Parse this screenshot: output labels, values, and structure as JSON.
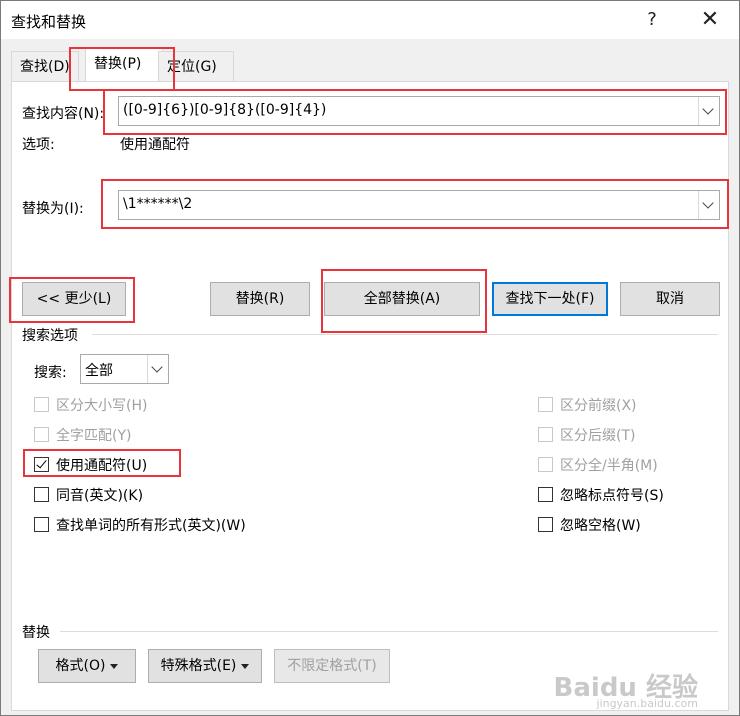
{
  "title": "查找和替换",
  "title_buttons": {
    "help": "?",
    "close": "✕"
  },
  "tabs": [
    "查找(D)",
    "替换(P)",
    "定位(G)"
  ],
  "find": {
    "label": "查找内容(N):",
    "value": "([0-9]{6})[0-9]{8}([0-9]{4})"
  },
  "options": {
    "label": "选项:",
    "value": "使用通配符"
  },
  "replace": {
    "label": "替换为(I):",
    "value": "\\1******\\2"
  },
  "buttons": {
    "less": "<< 更少(L)",
    "replace": "替换(R)",
    "replace_all": "全部替换(A)",
    "find_next": "查找下一处(F)",
    "cancel": "取消"
  },
  "search_options": {
    "title": "搜索选项",
    "search_label": "搜索:",
    "search_value": "全部"
  },
  "checkboxes_left": [
    {
      "label": "区分大小写(H)",
      "checked": false,
      "enabled": false
    },
    {
      "label": "全字匹配(Y)",
      "checked": false,
      "enabled": false
    },
    {
      "label": "使用通配符(U)",
      "checked": true,
      "enabled": true
    },
    {
      "label": "同音(英文)(K)",
      "checked": false,
      "enabled": true
    },
    {
      "label": "查找单词的所有形式(英文)(W)",
      "checked": false,
      "enabled": true
    }
  ],
  "checkboxes_right": [
    {
      "label": "区分前缀(X)",
      "checked": false,
      "enabled": false
    },
    {
      "label": "区分后缀(T)",
      "checked": false,
      "enabled": false
    },
    {
      "label": "区分全/半角(M)",
      "checked": false,
      "enabled": false
    },
    {
      "label": "忽略标点符号(S)",
      "checked": false,
      "enabled": true
    },
    {
      "label": "忽略空格(W)",
      "checked": false,
      "enabled": true
    }
  ],
  "replace_section": {
    "title": "替换",
    "format": "格式(O)",
    "special": "特殊格式(E)",
    "no_format": "不限定格式(T)"
  },
  "watermark": {
    "main": "Baidu 经验",
    "sub": "jingyan.baidu.com"
  },
  "colors": {
    "highlight": "#e8353b",
    "accent": "#0078d7"
  }
}
